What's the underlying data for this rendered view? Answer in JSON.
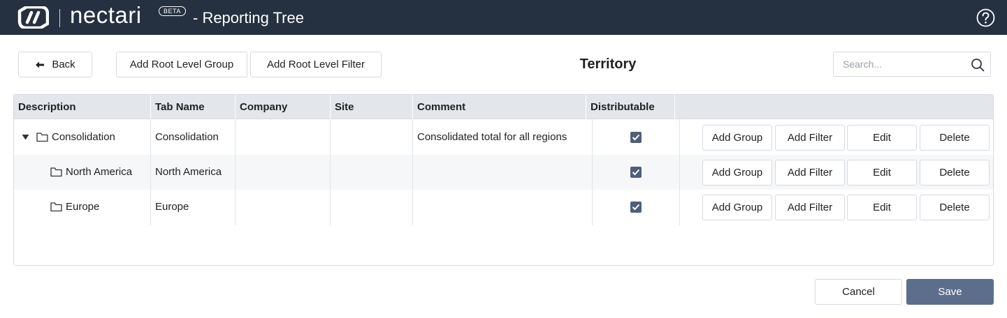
{
  "header": {
    "brand": "nectari",
    "beta": "BETA",
    "title": "- Reporting Tree"
  },
  "toolbar": {
    "back_label": "Back",
    "add_root_group_label": "Add Root Level Group",
    "add_root_filter_label": "Add Root Level Filter"
  },
  "page_title": "Territory",
  "search": {
    "placeholder": "Search..."
  },
  "grid": {
    "columns": [
      "Description",
      "Tab Name",
      "Company",
      "Site",
      "Comment",
      "Distributable"
    ],
    "rows": [
      {
        "description": "Consolidation",
        "tab_name": "Consolidation",
        "company": "",
        "site": "",
        "comment": "Consolidated total for all regions",
        "distributable": true,
        "expanded": true,
        "level": 0
      },
      {
        "description": "North America",
        "tab_name": "North America",
        "company": "",
        "site": "",
        "comment": "",
        "distributable": true,
        "level": 1
      },
      {
        "description": "Europe",
        "tab_name": "Europe",
        "company": "",
        "site": "",
        "comment": "",
        "distributable": true,
        "level": 1
      }
    ],
    "row_actions": {
      "add_group": "Add Group",
      "add_filter": "Add Filter",
      "edit": "Edit",
      "delete": "Delete"
    }
  },
  "footer": {
    "cancel_label": "Cancel",
    "save_label": "Save"
  },
  "colors": {
    "header_bg": "#253140",
    "accent": "#5d6e8c",
    "checkbox": "#4f5f7a"
  },
  "icons": {
    "logo": "nectari-logo-icon",
    "help": "help-icon",
    "back": "arrow-left-icon",
    "search": "search-icon",
    "expand": "caret-down-icon",
    "folder": "folder-icon",
    "check": "checkbox-checked-icon"
  }
}
